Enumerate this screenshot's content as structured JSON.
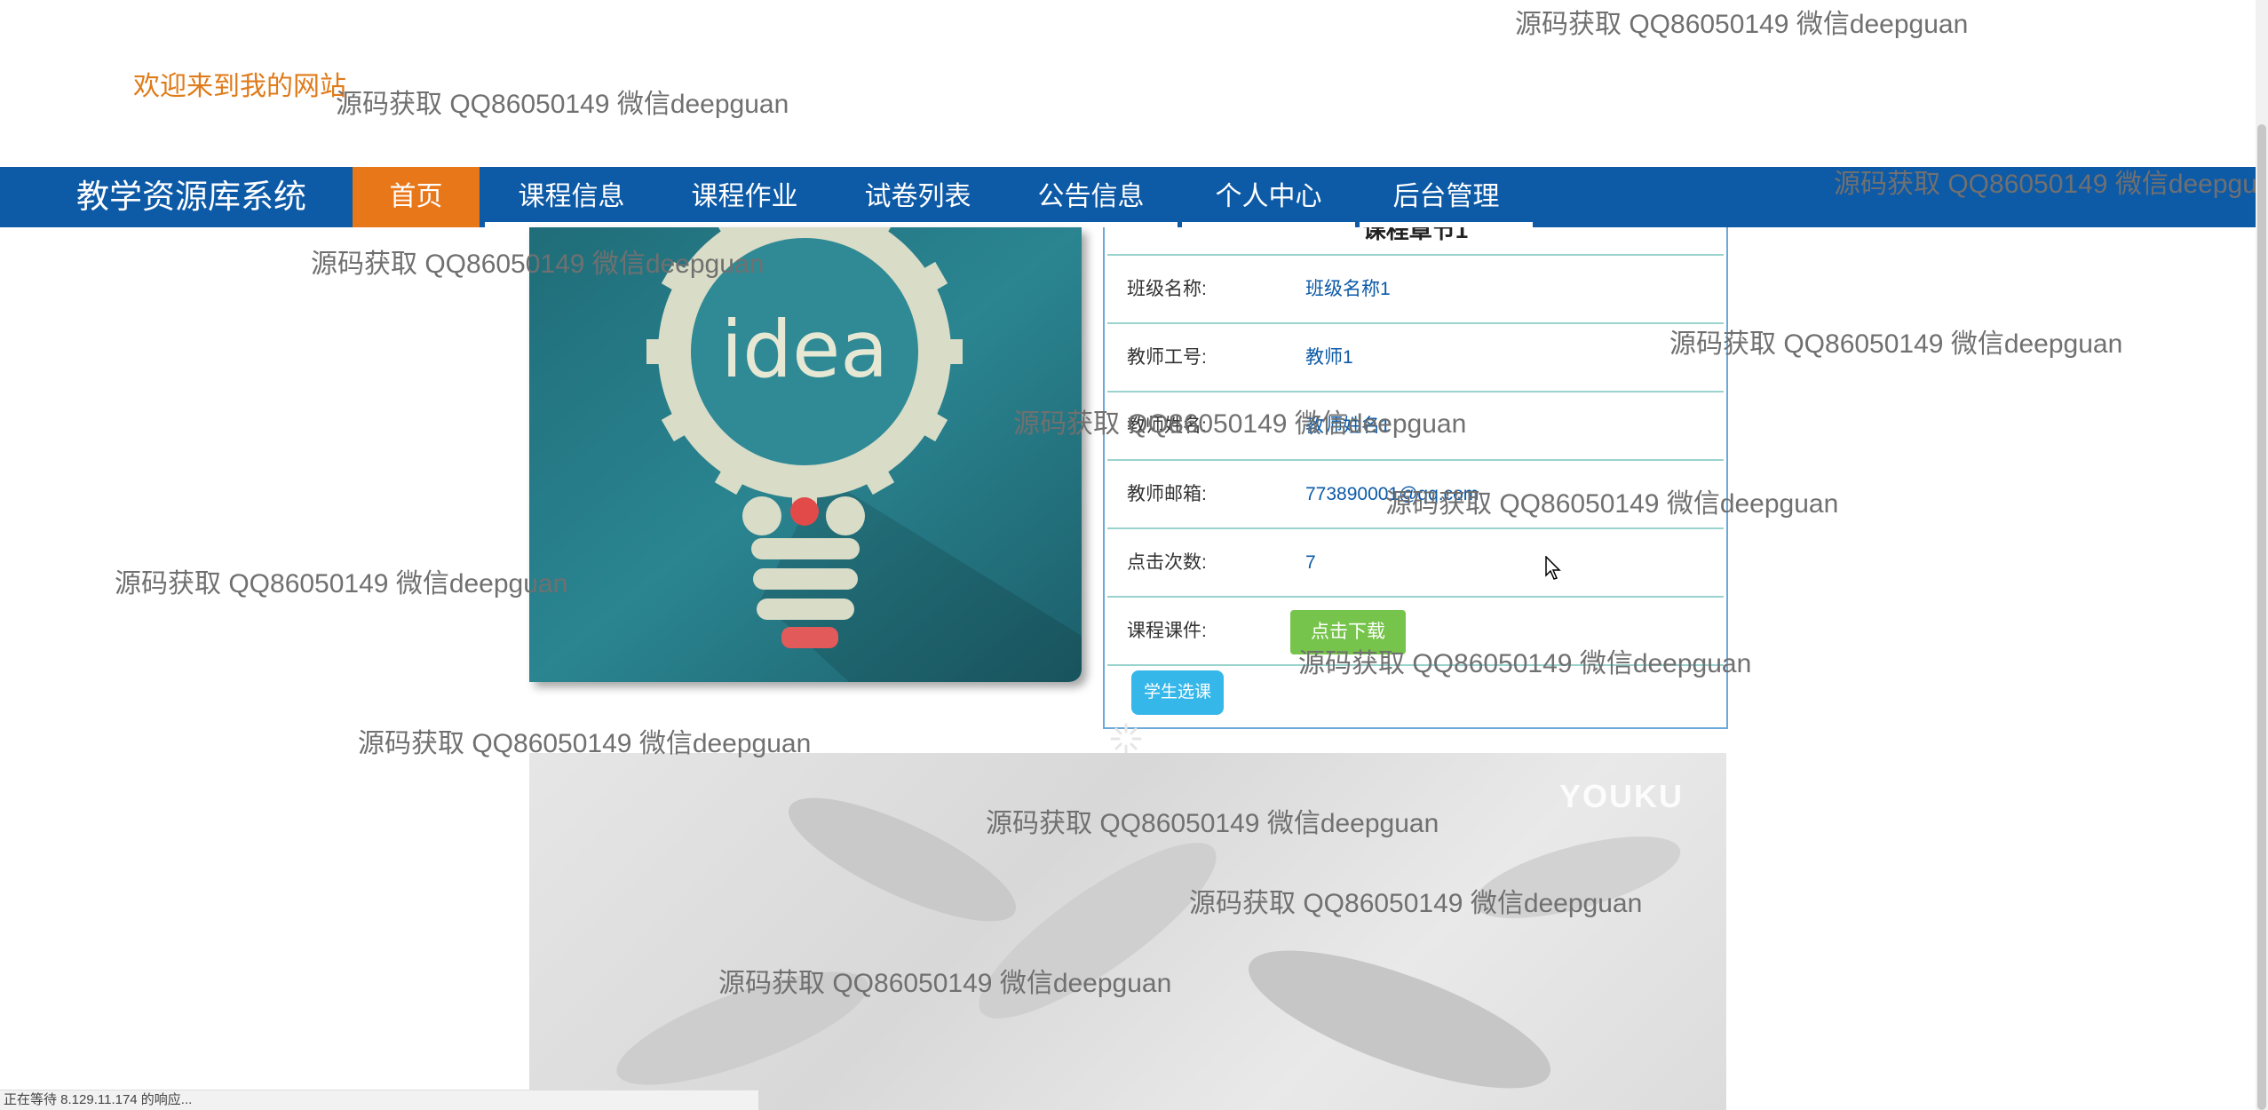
{
  "welcome": "欢迎来到我的网站",
  "nav": {
    "brand": "教学资源库系统",
    "items": [
      {
        "label": "首页",
        "active": true
      },
      {
        "label": "课程信息",
        "active": false
      },
      {
        "label": "课程作业",
        "active": false
      },
      {
        "label": "试卷列表",
        "active": false
      },
      {
        "label": "公告信息",
        "active": false
      },
      {
        "label": "个人中心",
        "active": false
      },
      {
        "label": "后台管理",
        "active": false
      }
    ]
  },
  "course_image": {
    "text": "idea"
  },
  "detail": {
    "title": "课程章节1",
    "rows": [
      {
        "label": "班级名称:",
        "value": "班级名称1"
      },
      {
        "label": "教师工号:",
        "value": "教师1"
      },
      {
        "label": "教师姓名:",
        "value": "教师姓名1"
      },
      {
        "label": "教师邮箱:",
        "value": "773890001@qq.com"
      },
      {
        "label": "点击次数:",
        "value": "7"
      }
    ],
    "courseware_label": "课程课件:",
    "download_button": "点击下载",
    "select_button": "学生选课"
  },
  "video": {
    "logo": "YOUKU"
  },
  "watermark": "源码获取 QQ86050149 微信deepguan",
  "status": "正在等待 8.129.11.174 的响应...",
  "colors": {
    "nav_bg": "#0d5aa7",
    "nav_active": "#e8771a",
    "welcome": "#e07b1a",
    "download": "#76c44b",
    "select": "#35b7ea"
  }
}
